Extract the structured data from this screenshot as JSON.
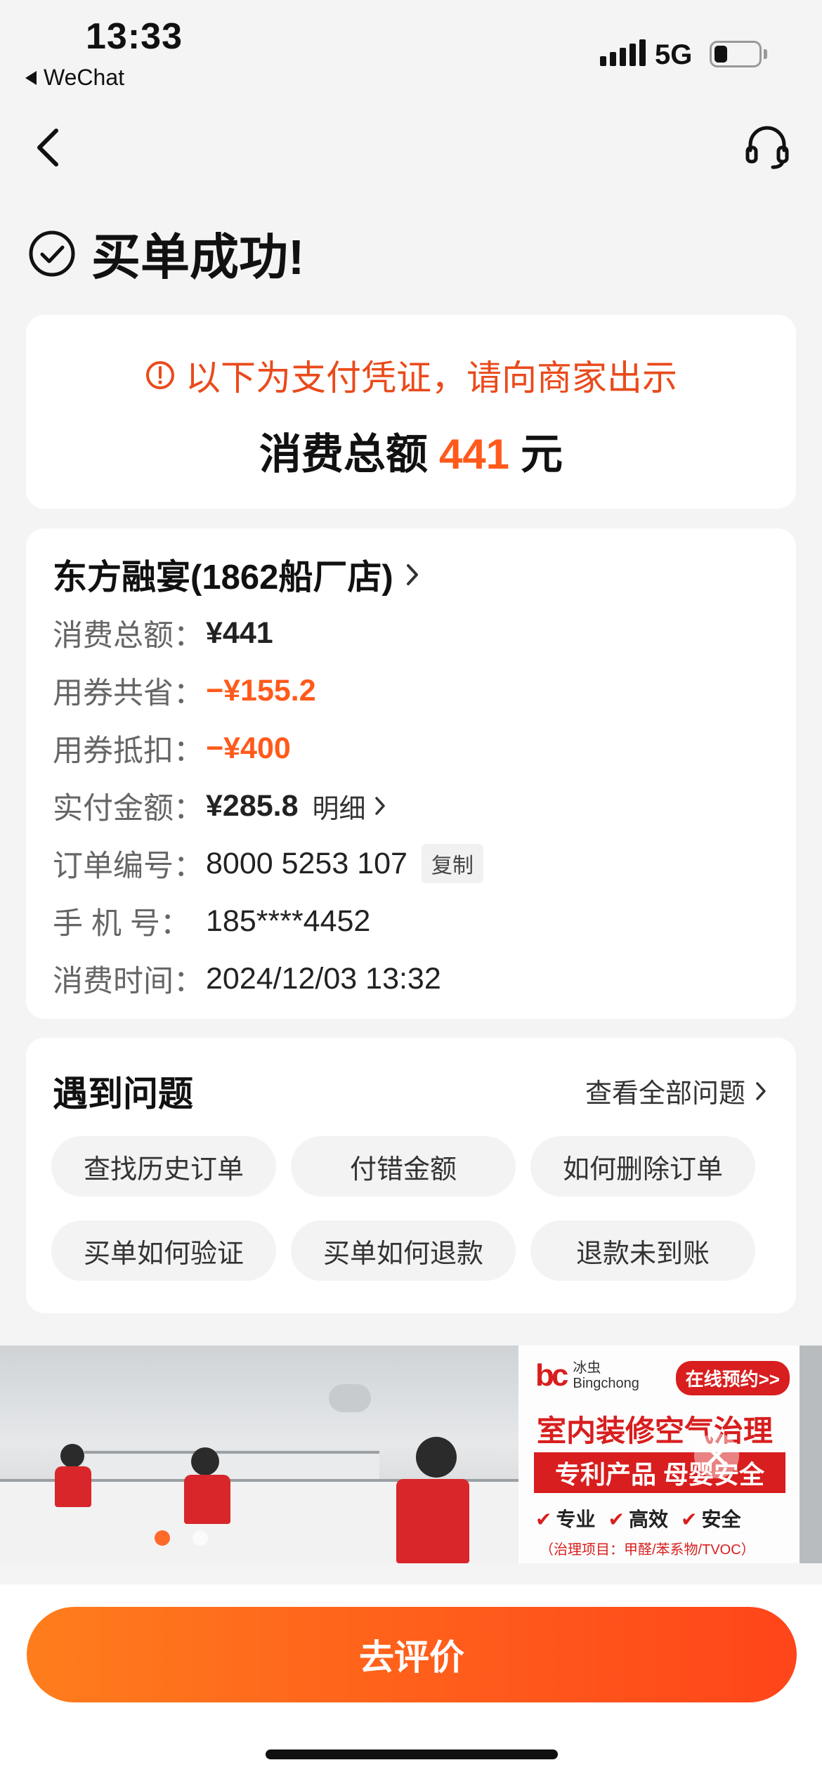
{
  "status_bar": {
    "time": "13:33",
    "back_app": "WeChat",
    "network": "5G"
  },
  "page": {
    "title": "买单成功!"
  },
  "voucher": {
    "notice": "以下为支付凭证，请向商家出示",
    "total_prefix": "消费总额",
    "total_amount": "441",
    "total_unit": "元"
  },
  "order": {
    "shop_name": "东方融宴(1862船厂店)",
    "rows": [
      {
        "label": "消费总额：",
        "value": "¥441"
      },
      {
        "label": "用券共省：",
        "value": "−¥155.2"
      },
      {
        "label": "用券抵扣：",
        "value": "−¥400"
      },
      {
        "label": "实付金额：",
        "value": "¥285.8",
        "extra": "明细"
      },
      {
        "label": "订单编号：",
        "value": "8000 5253 107",
        "extra": "复制"
      },
      {
        "label": "手 机 号：",
        "value": "185****4452"
      },
      {
        "label": "消费时间：",
        "value": "2024/12/03 13:32"
      }
    ]
  },
  "problems": {
    "title": "遇到问题",
    "view_all": "查看全部问题",
    "chips": [
      "查找历史订单",
      "付错金额",
      "如何删除订单",
      "买单如何验证",
      "买单如何退款",
      "退款未到账"
    ]
  },
  "ad": {
    "brand_name_cn": "冰虫",
    "brand_name_en": "Bingchong",
    "book": "在线预约>>",
    "headline": "室内装修空气治理",
    "subline": "专利产品 母婴安全",
    "checks": [
      "专业",
      "高效",
      "安全"
    ],
    "footnote": "（治理项目：甲醛/苯系物/TVOC）",
    "carousel_active_index": 0
  },
  "cta": {
    "label": "去评价"
  }
}
